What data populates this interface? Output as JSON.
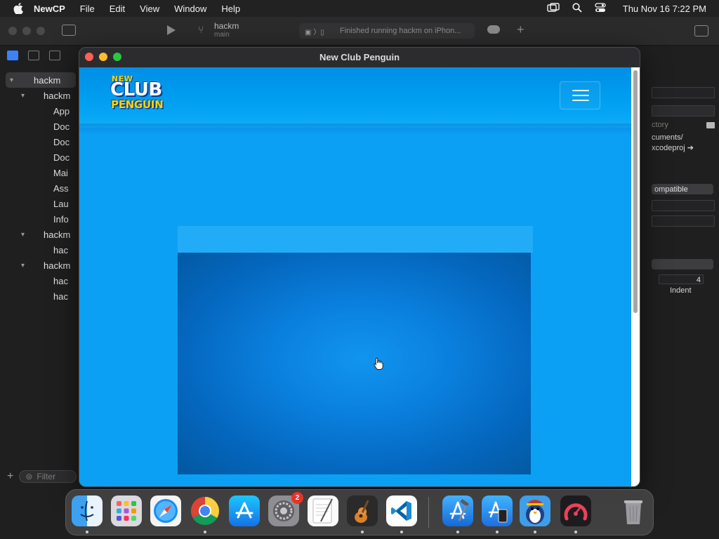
{
  "menubar": {
    "app_name": "NewCP",
    "menus": [
      "File",
      "Edit",
      "View",
      "Window",
      "Help"
    ],
    "clock": "Thu Nov 16  7:22 PM"
  },
  "xcode": {
    "scheme": "hackm",
    "branch": "main",
    "status": "Finished running hackm on iPhon...",
    "navigator": {
      "items": [
        {
          "label": "hackm"
        },
        {
          "label": "hackm"
        },
        {
          "label": "App"
        },
        {
          "label": "Doc"
        },
        {
          "label": "Doc"
        },
        {
          "label": "Doc"
        },
        {
          "label": "Mai"
        },
        {
          "label": "Ass"
        },
        {
          "label": "Lau"
        },
        {
          "label": "Info"
        },
        {
          "label": "hackm"
        },
        {
          "label": "hac"
        },
        {
          "label": "hackm"
        },
        {
          "label": "hac"
        },
        {
          "label": "hac"
        }
      ],
      "filter_placeholder": "Filter"
    },
    "inspector": {
      "location_label": "ctory",
      "path_line1": "cuments/",
      "path_line2": "xcodeproj",
      "compat_popup": "ompatible",
      "indent_value": "4",
      "indent_label": "Indent"
    }
  },
  "club_penguin_window": {
    "title": "New Club Penguin",
    "logo": {
      "new": "NEW",
      "club": "CLUB",
      "penguin": "PENGUIN"
    },
    "menu_button": "menu"
  },
  "dock": {
    "apps": [
      {
        "name": "Finder",
        "icon": "finder-icon",
        "running": true
      },
      {
        "name": "Launchpad",
        "icon": "launchpad-icon",
        "running": false
      },
      {
        "name": "Safari",
        "icon": "safari-icon",
        "running": false
      },
      {
        "name": "Chrome",
        "icon": "chrome-icon",
        "running": true
      },
      {
        "name": "App Store",
        "icon": "app-store-icon",
        "running": false
      },
      {
        "name": "System Settings",
        "icon": "system-settings-icon",
        "running": false,
        "badge": "2"
      },
      {
        "name": "TextEdit",
        "icon": "textedit-icon",
        "running": false
      },
      {
        "name": "GarageBand",
        "icon": "garageband-icon",
        "running": true
      },
      {
        "name": "Visual Studio Code",
        "icon": "vscode-icon",
        "running": true
      },
      {
        "name": "Xcode",
        "icon": "xcode-icon",
        "running": true
      },
      {
        "name": "Simulator",
        "icon": "simulator-icon",
        "running": true
      },
      {
        "name": "NewCP",
        "icon": "newcp-penguin-icon",
        "running": true
      },
      {
        "name": "Instruments",
        "icon": "instruments-icon",
        "running": true
      },
      {
        "name": "Trash",
        "icon": "trash-icon",
        "running": false
      }
    ]
  },
  "colors": {
    "cp_blue": "#0ca0f5",
    "cp_game_dark": "#03589f",
    "menubar_bg": "#222223"
  }
}
